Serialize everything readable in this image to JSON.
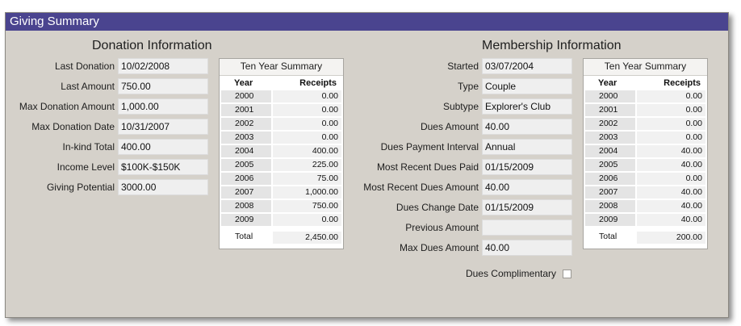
{
  "panel_title": "Giving Summary",
  "donation": {
    "title": "Donation Information",
    "fields": [
      {
        "label": "Last Donation",
        "value": "10/02/2008"
      },
      {
        "label": "Last Amount",
        "value": "750.00"
      },
      {
        "label": "Max Donation Amount",
        "value": "1,000.00"
      },
      {
        "label": "Max Donation Date",
        "value": "10/31/2007"
      },
      {
        "label": "In-kind Total",
        "value": "400.00"
      },
      {
        "label": "Income Level",
        "value": "$100K-$150K"
      },
      {
        "label": "Giving Potential",
        "value": "3000.00"
      }
    ],
    "summary": {
      "title": "Ten Year Summary",
      "col_year": "Year",
      "col_value": "Receipts",
      "rows": [
        {
          "year": "2000",
          "value": "0.00"
        },
        {
          "year": "2001",
          "value": "0.00"
        },
        {
          "year": "2002",
          "value": "0.00"
        },
        {
          "year": "2003",
          "value": "0.00"
        },
        {
          "year": "2004",
          "value": "400.00"
        },
        {
          "year": "2005",
          "value": "225.00"
        },
        {
          "year": "2006",
          "value": "75.00"
        },
        {
          "year": "2007",
          "value": "1,000.00"
        },
        {
          "year": "2008",
          "value": "750.00"
        },
        {
          "year": "2009",
          "value": "0.00"
        }
      ],
      "total_label": "Total",
      "total_value": "2,450.00"
    }
  },
  "membership": {
    "title": "Membership Information",
    "fields": [
      {
        "label": "Started",
        "value": "03/07/2004"
      },
      {
        "label": "Type",
        "value": "Couple"
      },
      {
        "label": "Subtype",
        "value": "Explorer's Club"
      },
      {
        "label": "Dues Amount",
        "value": "40.00"
      },
      {
        "label": "Dues Payment Interval",
        "value": "Annual"
      },
      {
        "label": "Most Recent Dues Paid",
        "value": "01/15/2009"
      },
      {
        "label": "Most Recent Dues Amount",
        "value": "40.00"
      },
      {
        "label": "Dues Change Date",
        "value": "01/15/2009"
      },
      {
        "label": "Previous Amount",
        "value": ""
      },
      {
        "label": "Max Dues Amount",
        "value": "40.00"
      }
    ],
    "complimentary_label": "Dues Complimentary",
    "complimentary_checked": false,
    "summary": {
      "title": "Ten Year Summary",
      "col_year": "Year",
      "col_value": "Receipts",
      "rows": [
        {
          "year": "2000",
          "value": "0.00"
        },
        {
          "year": "2001",
          "value": "0.00"
        },
        {
          "year": "2002",
          "value": "0.00"
        },
        {
          "year": "2003",
          "value": "0.00"
        },
        {
          "year": "2004",
          "value": "40.00"
        },
        {
          "year": "2005",
          "value": "40.00"
        },
        {
          "year": "2006",
          "value": "0.00"
        },
        {
          "year": "2007",
          "value": "40.00"
        },
        {
          "year": "2008",
          "value": "40.00"
        },
        {
          "year": "2009",
          "value": "40.00"
        }
      ],
      "total_label": "Total",
      "total_value": "200.00"
    }
  },
  "colors": {
    "titlebar": "#4a448f",
    "panel_bg": "#d5d1ca",
    "field_bg": "#efefef"
  }
}
